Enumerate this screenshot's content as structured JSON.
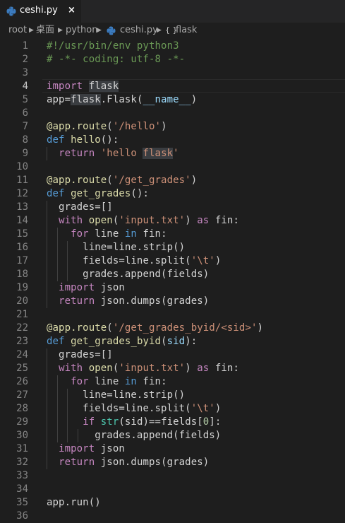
{
  "tab": {
    "label": "ceshi.py",
    "close": "×"
  },
  "breadcrumb": {
    "items": [
      "root",
      "桌面",
      "python",
      "ceshi.py",
      "flask"
    ],
    "symbol_glyph": "{ }"
  },
  "editor": {
    "current_line": 4,
    "lines": [
      {
        "n": "1"
      },
      {
        "n": "2"
      },
      {
        "n": "3"
      },
      {
        "n": "4"
      },
      {
        "n": "5"
      },
      {
        "n": "6"
      },
      {
        "n": "7"
      },
      {
        "n": "8"
      },
      {
        "n": "9"
      },
      {
        "n": "10"
      },
      {
        "n": "11"
      },
      {
        "n": "12"
      },
      {
        "n": "13"
      },
      {
        "n": "14"
      },
      {
        "n": "15"
      },
      {
        "n": "16"
      },
      {
        "n": "17"
      },
      {
        "n": "18"
      },
      {
        "n": "19"
      },
      {
        "n": "20"
      },
      {
        "n": "21"
      },
      {
        "n": "22"
      },
      {
        "n": "23"
      },
      {
        "n": "24"
      },
      {
        "n": "25"
      },
      {
        "n": "26"
      },
      {
        "n": "27"
      },
      {
        "n": "28"
      },
      {
        "n": "29"
      },
      {
        "n": "30"
      },
      {
        "n": "31"
      },
      {
        "n": "32"
      },
      {
        "n": "33"
      },
      {
        "n": "34"
      },
      {
        "n": "35"
      },
      {
        "n": "36"
      }
    ],
    "code": [
      [
        [
          "c",
          "#!/usr/bin/env python3"
        ]
      ],
      [
        [
          "c",
          "# -*- coding: utf-8 -*-"
        ]
      ],
      [],
      [
        [
          "k",
          "import"
        ],
        [
          "p",
          " "
        ],
        [
          "hl",
          "flask"
        ]
      ],
      [
        [
          "p",
          "app="
        ],
        [
          "hl",
          "flask"
        ],
        [
          "p",
          ".Flask("
        ],
        [
          "v",
          "__name__"
        ],
        [
          "p",
          ")"
        ]
      ],
      [],
      [
        [
          "f",
          "@app.route"
        ],
        [
          "p",
          "("
        ],
        [
          "s",
          "'/hello'"
        ],
        [
          "p",
          ")"
        ]
      ],
      [
        [
          "d",
          "def"
        ],
        [
          "p",
          " "
        ],
        [
          "f",
          "hello"
        ],
        [
          "p",
          "():"
        ]
      ],
      [
        [
          "p",
          "  "
        ],
        [
          "k",
          "return"
        ],
        [
          "p",
          " "
        ],
        [
          "s",
          "'hello "
        ],
        [
          "hls",
          "flask"
        ],
        [
          "s",
          "'"
        ]
      ],
      [],
      [
        [
          "f",
          "@app.route"
        ],
        [
          "p",
          "("
        ],
        [
          "s",
          "'/get_grades'"
        ],
        [
          "p",
          ")"
        ]
      ],
      [
        [
          "d",
          "def"
        ],
        [
          "p",
          " "
        ],
        [
          "f",
          "get_grades"
        ],
        [
          "p",
          "():"
        ]
      ],
      [
        [
          "p",
          "  grades=[]"
        ]
      ],
      [
        [
          "p",
          "  "
        ],
        [
          "k",
          "with"
        ],
        [
          "p",
          " "
        ],
        [
          "f",
          "open"
        ],
        [
          "p",
          "("
        ],
        [
          "s",
          "'input.txt'"
        ],
        [
          "p",
          ") "
        ],
        [
          "k",
          "as"
        ],
        [
          "p",
          " fin:"
        ]
      ],
      [
        [
          "p",
          "    "
        ],
        [
          "k",
          "for"
        ],
        [
          "p",
          " line "
        ],
        [
          "d",
          "in"
        ],
        [
          "p",
          " fin:"
        ]
      ],
      [
        [
          "p",
          "      line=line.strip()"
        ]
      ],
      [
        [
          "p",
          "      fields=line.split("
        ],
        [
          "s",
          "'\\t'"
        ],
        [
          "p",
          ")"
        ]
      ],
      [
        [
          "p",
          "      grades.append(fields)"
        ]
      ],
      [
        [
          "p",
          "  "
        ],
        [
          "k",
          "import"
        ],
        [
          "p",
          " json"
        ]
      ],
      [
        [
          "p",
          "  "
        ],
        [
          "k",
          "return"
        ],
        [
          "p",
          " json.dumps(grades)"
        ]
      ],
      [],
      [
        [
          "f",
          "@app.route"
        ],
        [
          "p",
          "("
        ],
        [
          "s",
          "'/get_grades_byid/<sid>'"
        ],
        [
          "p",
          ")"
        ]
      ],
      [
        [
          "d",
          "def"
        ],
        [
          "p",
          " "
        ],
        [
          "f",
          "get_grades_byid"
        ],
        [
          "p",
          "("
        ],
        [
          "v",
          "sid"
        ],
        [
          "p",
          "):"
        ]
      ],
      [
        [
          "p",
          "  grades=[]"
        ]
      ],
      [
        [
          "p",
          "  "
        ],
        [
          "k",
          "with"
        ],
        [
          "p",
          " "
        ],
        [
          "f",
          "open"
        ],
        [
          "p",
          "("
        ],
        [
          "s",
          "'input.txt'"
        ],
        [
          "p",
          ") "
        ],
        [
          "k",
          "as"
        ],
        [
          "p",
          " fin:"
        ]
      ],
      [
        [
          "p",
          "    "
        ],
        [
          "k",
          "for"
        ],
        [
          "p",
          " line "
        ],
        [
          "d",
          "in"
        ],
        [
          "p",
          " fin:"
        ]
      ],
      [
        [
          "p",
          "      line=line.strip()"
        ]
      ],
      [
        [
          "p",
          "      fields=line.split("
        ],
        [
          "s",
          "'\\t'"
        ],
        [
          "p",
          ")"
        ]
      ],
      [
        [
          "p",
          "      "
        ],
        [
          "k",
          "if"
        ],
        [
          "p",
          " "
        ],
        [
          "t",
          "str"
        ],
        [
          "p",
          "(sid)==fields["
        ],
        [
          "n",
          "0"
        ],
        [
          "p",
          "]:"
        ]
      ],
      [
        [
          "p",
          "        grades.append(fields)"
        ]
      ],
      [
        [
          "p",
          "  "
        ],
        [
          "k",
          "import"
        ],
        [
          "p",
          " json"
        ]
      ],
      [
        [
          "p",
          "  "
        ],
        [
          "k",
          "return"
        ],
        [
          "p",
          " json.dumps(grades)"
        ]
      ],
      [],
      [],
      [
        [
          "p",
          "app.run()"
        ]
      ],
      []
    ]
  },
  "icons": {
    "python_file": "python-icon",
    "symbol": "module-symbol-icon"
  },
  "colors": {
    "background": "#1e1e1e",
    "keyword": "#c586c0",
    "string": "#ce9178",
    "comment": "#6a9955",
    "function": "#dcdcaa"
  }
}
